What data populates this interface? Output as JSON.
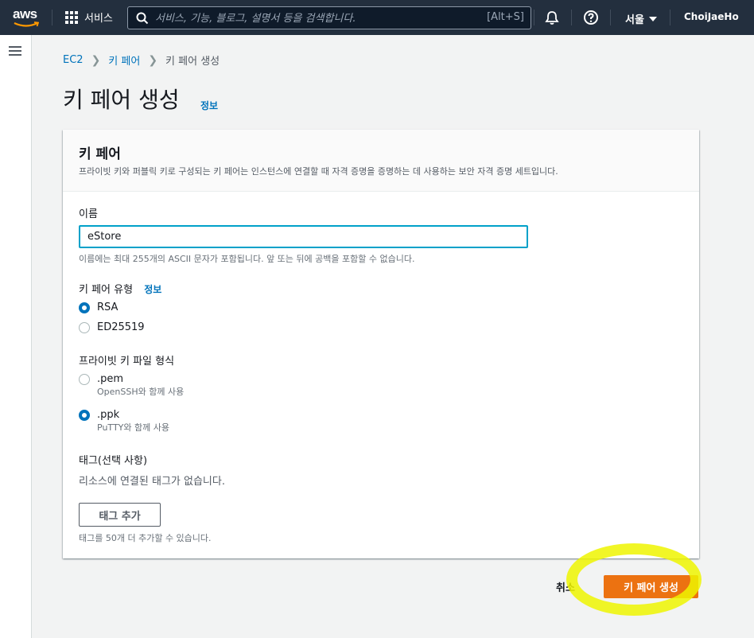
{
  "nav": {
    "logo": "aws",
    "services": "서비스",
    "search_placeholder": "서비스, 기능, 블로그, 설명서 등을 검색합니다.",
    "search_shortcut": "[Alt+S]",
    "region": "서울",
    "user": "ChoiJaeHo"
  },
  "breadcrumb": [
    "EC2",
    "키 페어",
    "키 페어 생성"
  ],
  "page": {
    "title": "키 페어 생성",
    "info": "정보"
  },
  "panel": {
    "title": "키 페어",
    "description": "프라이빗 키와 퍼블릭 키로 구성되는 키 페어는 인스턴스에 연결할 때 자격 증명을 증명하는 데 사용하는 보안 자격 증명 세트입니다.",
    "name_label": "이름",
    "name_value": "eStore",
    "name_hint": "이름에는 최대 255개의 ASCII 문자가 포함됩니다. 앞 또는 뒤에 공백을 포함할 수 없습니다.",
    "type_label": "키 페어 유형",
    "type_info": "정보",
    "type_options": [
      {
        "label": "RSA",
        "checked": true
      },
      {
        "label": "ED25519",
        "checked": false
      }
    ],
    "format_label": "프라이빗 키 파일 형식",
    "format_options": [
      {
        "label": ".pem",
        "sub": "OpenSSH와 함께 사용",
        "checked": false
      },
      {
        "label": ".ppk",
        "sub": "PuTTY와 함께 사용",
        "checked": true
      }
    ],
    "tags_label": "태그(선택 사항)",
    "tags_empty": "리소스에 연결된 태그가 없습니다.",
    "add_tag": "태그 추가",
    "tags_hint": "태그를 50개 더 추가할 수 있습니다."
  },
  "actions": {
    "cancel": "취소",
    "create": "키 페어 생성"
  },
  "colors": {
    "nav_bg": "#232f3e",
    "link": "#0073bb",
    "primary": "#ec7211",
    "highlight": "#eef500"
  },
  "icons": [
    "aws-logo-icon",
    "grid-icon",
    "search-icon",
    "bell-icon",
    "help-icon",
    "menu-icon"
  ]
}
